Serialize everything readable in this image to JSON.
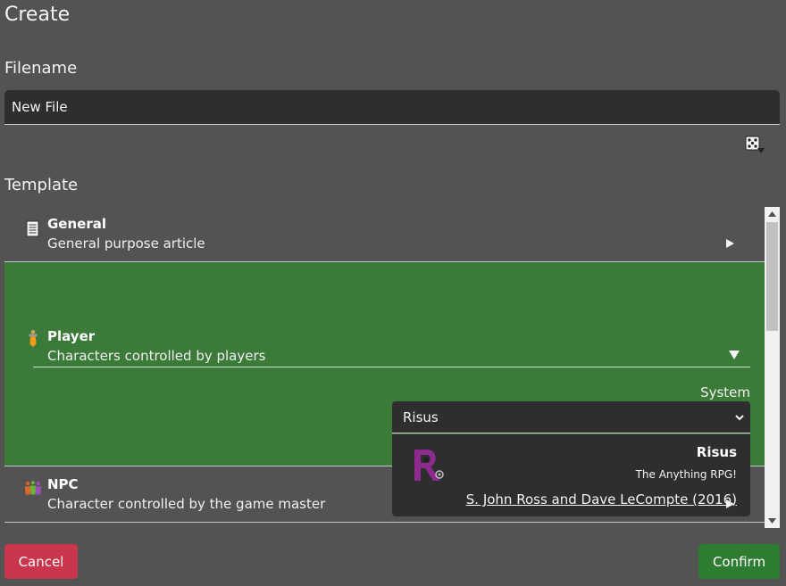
{
  "dialog": {
    "title": "Create"
  },
  "filename": {
    "label": "Filename",
    "value": "New File"
  },
  "template": {
    "label": "Template",
    "items": [
      {
        "title": "General",
        "subtitle": "General purpose article",
        "icon": "document-icon",
        "expanded": false
      },
      {
        "title": "Player",
        "subtitle": "Characters controlled by players",
        "icon": "player-figure-icon",
        "expanded": true
      },
      {
        "title": "NPC",
        "subtitle": "Character controlled by the game master",
        "icon": "npc-group-icon",
        "expanded": false
      }
    ]
  },
  "system": {
    "label": "System",
    "selected": "Risus",
    "card": {
      "name": "Risus",
      "tagline": "The Anything RPG!",
      "credit": "S. John Ross and Dave LeCompte (2016)"
    }
  },
  "buttons": {
    "cancel": "Cancel",
    "confirm": "Confirm"
  },
  "colors": {
    "background": "#535353",
    "selected_row": "#3b7a38",
    "cancel": "#c9364b",
    "confirm": "#2e7b32",
    "input": "#2e2e2e"
  }
}
